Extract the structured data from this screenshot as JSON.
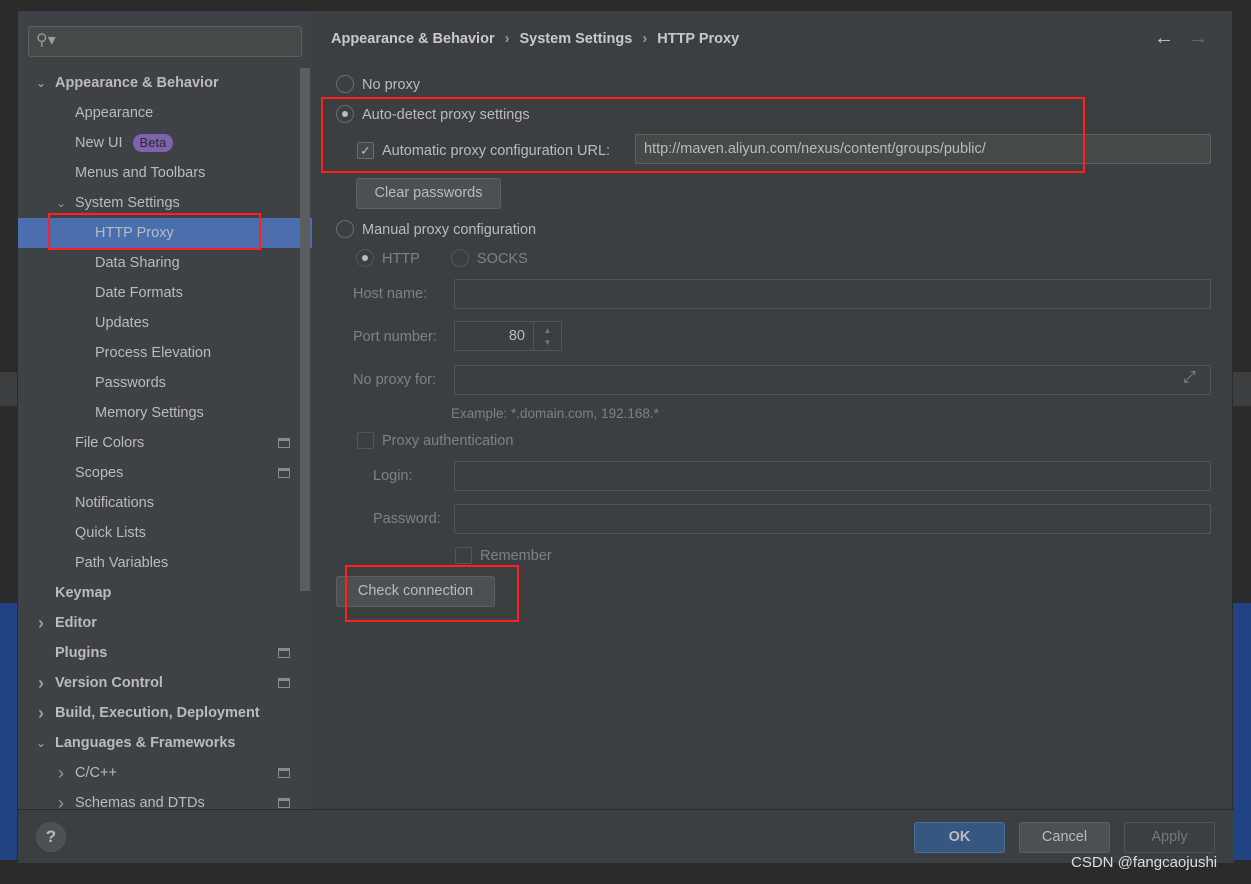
{
  "breadcrumb": [
    "Appearance & Behavior",
    "System Settings",
    "HTTP Proxy"
  ],
  "search": {
    "placeholder": ""
  },
  "sidebar": {
    "items": [
      {
        "label": "Appearance & Behavior",
        "level": 0,
        "bold": true,
        "chevron": "down"
      },
      {
        "label": "Appearance",
        "level": 1
      },
      {
        "label": "New UI",
        "level": 1,
        "badge": "Beta"
      },
      {
        "label": "Menus and Toolbars",
        "level": 1
      },
      {
        "label": "System Settings",
        "level": 1,
        "chevron": "down"
      },
      {
        "label": "HTTP Proxy",
        "level": 2,
        "selected": true
      },
      {
        "label": "Data Sharing",
        "level": 2
      },
      {
        "label": "Date Formats",
        "level": 2
      },
      {
        "label": "Updates",
        "level": 2
      },
      {
        "label": "Process Elevation",
        "level": 2
      },
      {
        "label": "Passwords",
        "level": 2
      },
      {
        "label": "Memory Settings",
        "level": 2
      },
      {
        "label": "File Colors",
        "level": 1,
        "project": true
      },
      {
        "label": "Scopes",
        "level": 1,
        "project": true
      },
      {
        "label": "Notifications",
        "level": 1
      },
      {
        "label": "Quick Lists",
        "level": 1
      },
      {
        "label": "Path Variables",
        "level": 1
      },
      {
        "label": "Keymap",
        "level": 0,
        "bold": true
      },
      {
        "label": "Editor",
        "level": 0,
        "bold": true,
        "chevron": "right"
      },
      {
        "label": "Plugins",
        "level": 0,
        "bold": true,
        "project": true
      },
      {
        "label": "Version Control",
        "level": 0,
        "bold": true,
        "chevron": "right",
        "project": true
      },
      {
        "label": "Build, Execution, Deployment",
        "level": 0,
        "bold": true,
        "chevron": "right"
      },
      {
        "label": "Languages & Frameworks",
        "level": 0,
        "bold": true,
        "chevron": "down"
      },
      {
        "label": "C/C++",
        "level": 1,
        "chevron": "right",
        "project": true
      },
      {
        "label": "Schemas and DTDs",
        "level": 1,
        "chevron": "right",
        "project": true
      }
    ]
  },
  "proxy": {
    "no_proxy": "No proxy",
    "auto_detect": "Auto-detect proxy settings",
    "auto_url_label": "Automatic proxy configuration URL:",
    "auto_url_value": "http://maven.aliyun.com/nexus/content/groups/public/",
    "auto_url_checked": true,
    "selected": "auto_detect",
    "clear_passwords": "Clear passwords",
    "manual": "Manual proxy configuration",
    "http": "HTTP",
    "socks": "SOCKS",
    "host_label": "Host name:",
    "host_value": "",
    "port_label": "Port number:",
    "port_value": "80",
    "no_proxy_for_label": "No proxy for:",
    "no_proxy_for_value": "",
    "example": "Example: *.domain.com, 192.168.*",
    "auth_label": "Proxy authentication",
    "login_label": "Login:",
    "password_label": "Password:",
    "remember": "Remember",
    "check_connection": "Check connection"
  },
  "footer": {
    "ok": "OK",
    "cancel": "Cancel",
    "apply": "Apply",
    "help": "?"
  },
  "watermark": "CSDN @fangcaojushi",
  "colors": {
    "selection": "#4b6eaf",
    "annotation": "#ff2020",
    "badge": "#7e63ae"
  }
}
